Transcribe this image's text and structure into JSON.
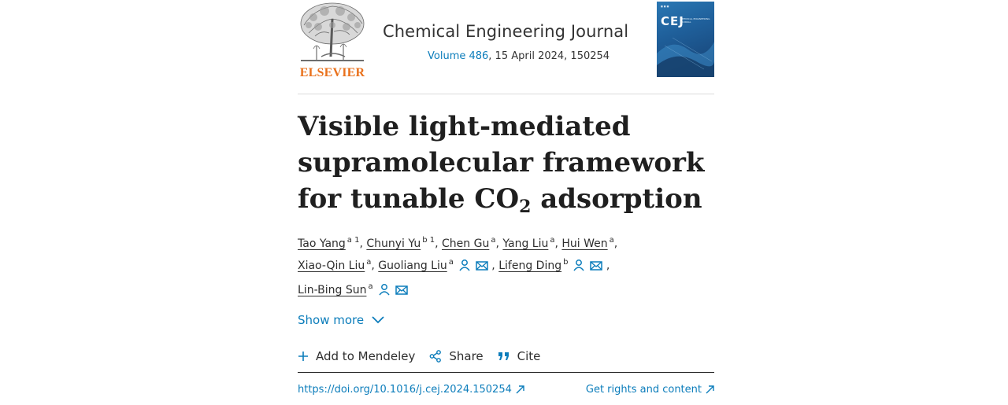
{
  "header": {
    "publisher_logo_text": "ELSEVIER",
    "journal_title": "Chemical Engineering Journal",
    "volume_link": "Volume 486",
    "issue_info": ", 15 April 2024, 150254",
    "cover_title": "CEJ",
    "cover_subtitle": "CHEMICAL ENGINEERING JOURNAL"
  },
  "article": {
    "title_part1": "Visible light-mediated supramolecular framework for tunable CO",
    "title_subscript": "2",
    "title_part2": " adsorption"
  },
  "authors": [
    {
      "name": "Tao Yang",
      "aff": "a 1",
      "sep": ", "
    },
    {
      "name": "Chunyi Yu",
      "aff": "b 1",
      "sep": ", "
    },
    {
      "name": "Chen Gu",
      "aff": "a",
      "sep": ", "
    },
    {
      "name": "Yang Liu",
      "aff": "a",
      "sep": ", "
    },
    {
      "name": "Hui Wen",
      "aff": "a",
      "sep": ","
    },
    {
      "name": "Xiao-Qin Liu",
      "aff": "a",
      "sep": ", "
    },
    {
      "name": "Guoliang Liu",
      "aff": "a",
      "sep": " , "
    },
    {
      "name": "Lifeng Ding",
      "aff": "b",
      "sep": " ,"
    },
    {
      "name": "Lin-Bing Sun",
      "aff": "a",
      "sep": ""
    }
  ],
  "show_more_label": "Show more",
  "actions": {
    "add_mendeley": "Add to Mendeley",
    "share": "Share",
    "cite": "Cite"
  },
  "links": {
    "doi": "https://doi.org/10.1016/j.cej.2024.150254",
    "rights": "Get rights and content"
  },
  "colors": {
    "link_blue": "#0c7dbb",
    "elsevier_orange": "#e9711c"
  },
  "icons": {
    "person": "person-icon",
    "mail": "mail-icon",
    "chevron": "chevron-down-icon",
    "plus": "plus-icon",
    "share": "share-icon",
    "cite": "quote-icon",
    "external": "external-link-icon"
  }
}
